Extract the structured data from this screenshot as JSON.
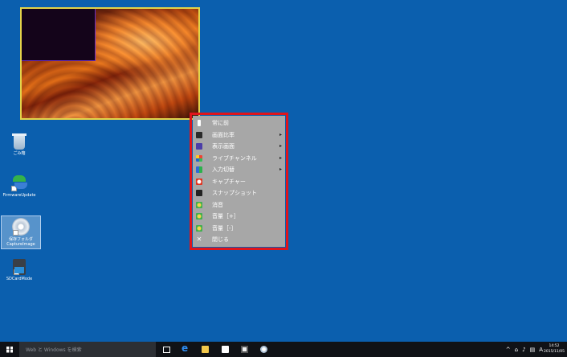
{
  "desktop_icons": [
    {
      "name": "recycle-bin",
      "label": "ごみ箱"
    },
    {
      "name": "firmware-update",
      "label": "FirmwareUpdate"
    },
    {
      "name": "saved-capture",
      "label": "保存フォルダ\nCaptureImage"
    },
    {
      "name": "sdcardmode",
      "label": "SDCardMode"
    }
  ],
  "context_menu": {
    "items": [
      {
        "label": "常に前",
        "icon": "pin-icon",
        "submenu": false
      },
      {
        "label": "画面比率",
        "icon": "aspect-ratio-icon",
        "submenu": true
      },
      {
        "label": "表示画面",
        "icon": "display-screen-icon",
        "submenu": true
      },
      {
        "label": "ライブチャンネル",
        "icon": "live-channel-icon",
        "submenu": true
      },
      {
        "label": "入力切替",
        "icon": "input-switch-icon",
        "submenu": true
      },
      {
        "label": "キャプチャー",
        "icon": "capture-icon",
        "submenu": false
      },
      {
        "label": "スナップショット",
        "icon": "snapshot-icon",
        "submenu": false
      },
      {
        "label": "消音",
        "icon": "mute-icon",
        "submenu": false
      },
      {
        "label": "音量［+］",
        "icon": "volume-up-icon",
        "submenu": false
      },
      {
        "label": "音量［-］",
        "icon": "volume-down-icon",
        "submenu": false
      },
      {
        "label": "閉じる",
        "icon": "close-icon",
        "submenu": false
      }
    ],
    "submenu_arrow": "▸",
    "highlight_color": "#e0141b"
  },
  "taskbar": {
    "search_placeholder": "Web と Windows を検索",
    "ime_indicator": "A",
    "clock_time": "14:52",
    "clock_date": "2015/11/05"
  },
  "colors": {
    "desktop": "#0b5fae",
    "menu_background": "#a7a7a7",
    "preview_border": "#e3d44a",
    "taskbar": "#101216"
  }
}
